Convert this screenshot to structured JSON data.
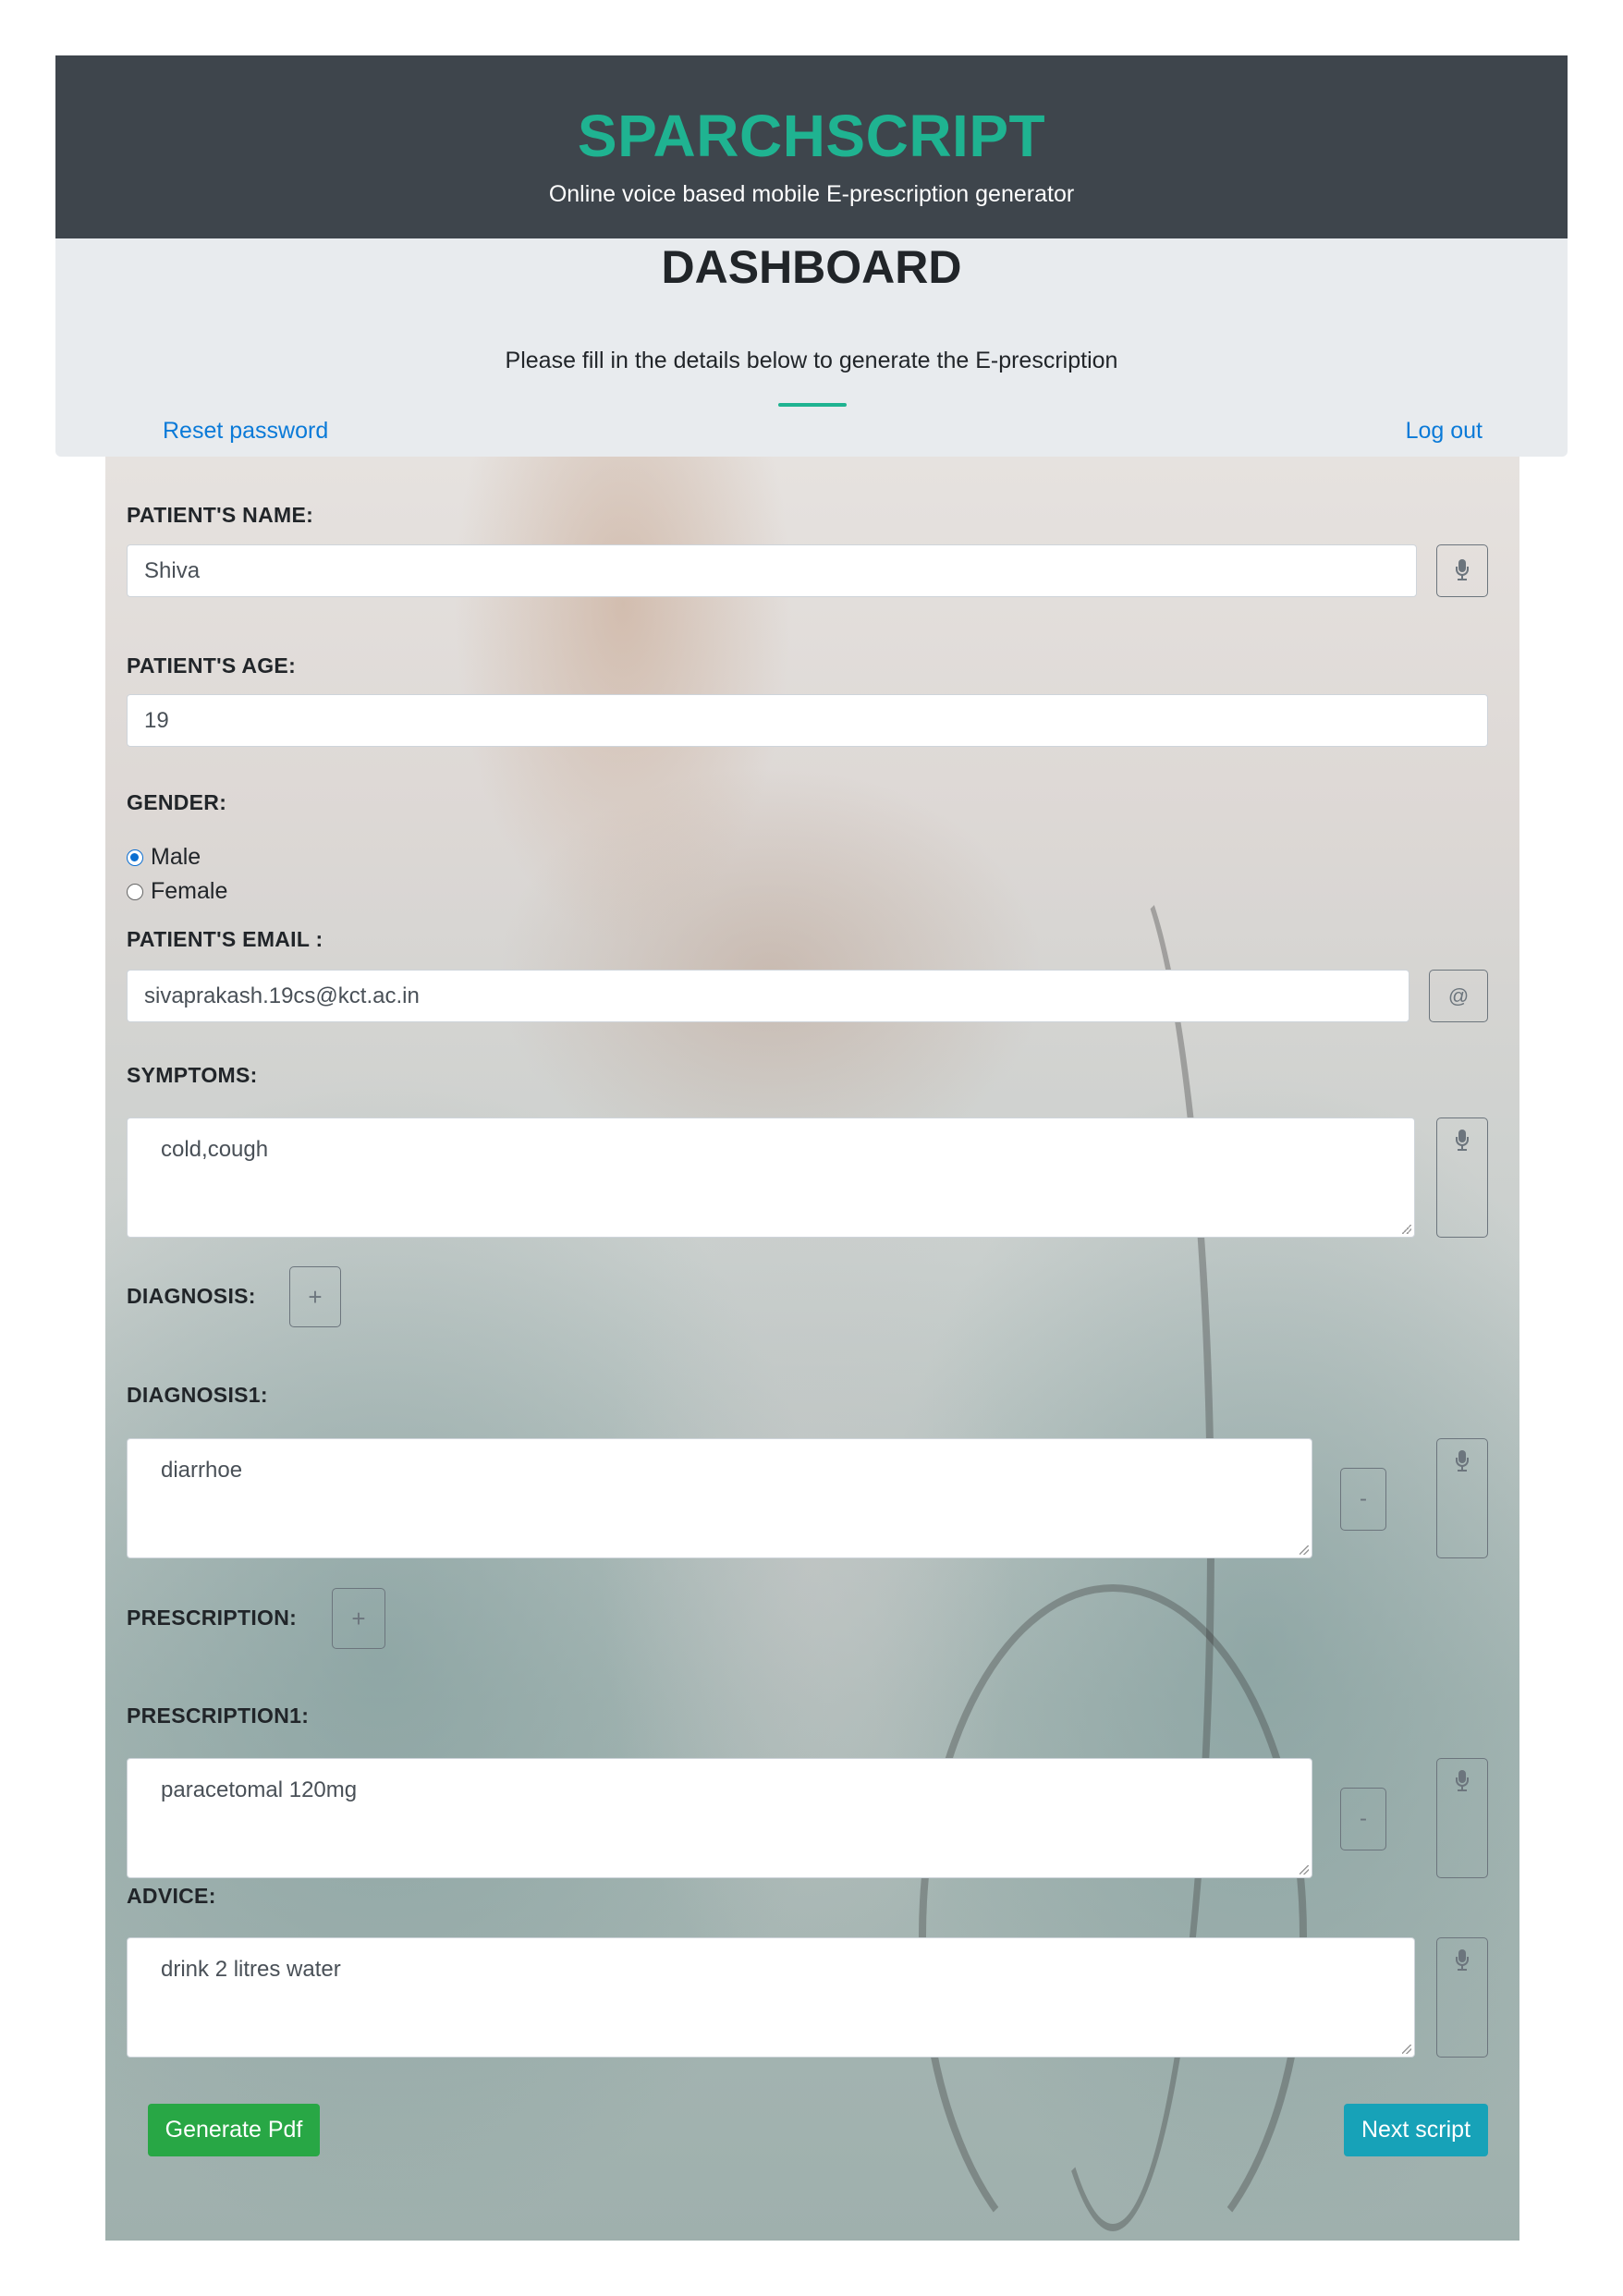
{
  "header": {
    "brand": "SPARCHSCRIPT",
    "tagline": "Online voice based mobile E-prescription generator"
  },
  "dashboard": {
    "title": "DASHBOARD",
    "subtitle": "Please fill in the details below to generate the E-prescription",
    "reset_password": "Reset password",
    "log_out": "Log out"
  },
  "form": {
    "patient_name": {
      "label": "PATIENT'S NAME:",
      "value": "Shiva"
    },
    "patient_age": {
      "label": "PATIENT'S AGE:",
      "value": "19"
    },
    "gender": {
      "label": "GENDER:",
      "options": [
        "Male",
        "Female"
      ],
      "selected": "Male"
    },
    "patient_email": {
      "label": "PATIENT'S EMAIL :",
      "value": "sivaprakash.19cs@kct.ac.in",
      "addon": "@"
    },
    "symptoms": {
      "label": "SYMPTOMS:",
      "value": "cold,cough"
    },
    "diagnosis": {
      "label": "DIAGNOSIS:",
      "add": "+"
    },
    "diagnosis1": {
      "label": "DIAGNOSIS1:",
      "value": "diarrhoe",
      "remove": "-"
    },
    "prescription": {
      "label": "PRESCRIPTION:",
      "add": "+"
    },
    "prescription1": {
      "label": "PRESCRIPTION1:",
      "value": "paracetomal 120mg",
      "remove": "-"
    },
    "advice": {
      "label": "ADVICE:",
      "value": "drink 2 litres water"
    }
  },
  "actions": {
    "generate_pdf": "Generate Pdf",
    "next_script": "Next script"
  },
  "icons": {
    "voice": "microphone-icon"
  },
  "colors": {
    "brand": "#1fb391",
    "header_bg": "#3e454c",
    "link": "#0a7ad8",
    "generate_btn": "#28a745",
    "next_btn": "#17a2b8"
  }
}
